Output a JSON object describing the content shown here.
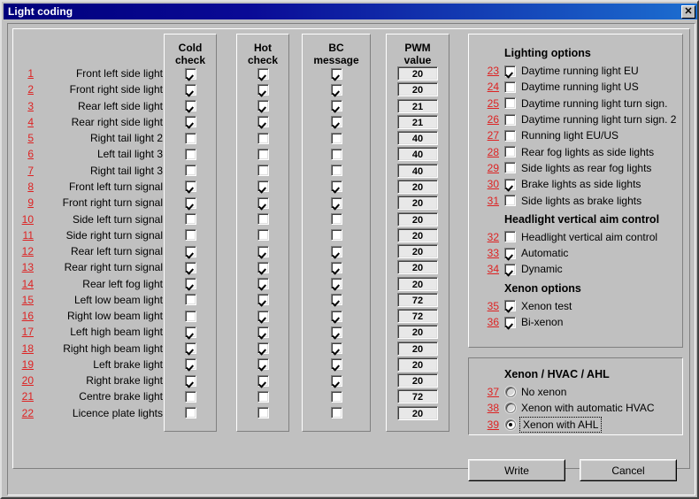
{
  "window": {
    "title": "Light coding",
    "close_label": "✕",
    "close_icon": "close-icon"
  },
  "columns": {
    "cold_check": "Cold\ncheck",
    "cold_check_line1": "Cold",
    "cold_check_line2": "check",
    "hot_check_line1": "Hot",
    "hot_check_line2": "check",
    "bc_message_line1": "BC",
    "bc_message_line2": "message",
    "pwm_line1": "PWM",
    "pwm_line2": "value"
  },
  "lights": [
    {
      "num": "1",
      "label": "Front left side light",
      "cold": true,
      "hot": true,
      "bc": true,
      "pwm": "20"
    },
    {
      "num": "2",
      "label": "Front right side light",
      "cold": true,
      "hot": true,
      "bc": true,
      "pwm": "20"
    },
    {
      "num": "3",
      "label": "Rear left side light",
      "cold": true,
      "hot": true,
      "bc": true,
      "pwm": "21"
    },
    {
      "num": "4",
      "label": "Rear right side light",
      "cold": true,
      "hot": true,
      "bc": true,
      "pwm": "21"
    },
    {
      "num": "5",
      "label": "Right tail light 2",
      "cold": false,
      "hot": false,
      "bc": false,
      "pwm": "40"
    },
    {
      "num": "6",
      "label": "Left tail light 3",
      "cold": false,
      "hot": false,
      "bc": false,
      "pwm": "40"
    },
    {
      "num": "7",
      "label": "Right tail light 3",
      "cold": false,
      "hot": false,
      "bc": false,
      "pwm": "40"
    },
    {
      "num": "8",
      "label": "Front left turn signal",
      "cold": true,
      "hot": true,
      "bc": true,
      "pwm": "20"
    },
    {
      "num": "9",
      "label": "Front right turn signal",
      "cold": true,
      "hot": true,
      "bc": true,
      "pwm": "20"
    },
    {
      "num": "10",
      "label": "Side left turn signal",
      "cold": false,
      "hot": false,
      "bc": false,
      "pwm": "20"
    },
    {
      "num": "11",
      "label": "Side right turn signal",
      "cold": false,
      "hot": false,
      "bc": false,
      "pwm": "20"
    },
    {
      "num": "12",
      "label": "Rear left turn signal",
      "cold": true,
      "hot": true,
      "bc": true,
      "pwm": "20"
    },
    {
      "num": "13",
      "label": "Rear right turn signal",
      "cold": true,
      "hot": true,
      "bc": true,
      "pwm": "20"
    },
    {
      "num": "14",
      "label": "Rear left fog light",
      "cold": true,
      "hot": true,
      "bc": true,
      "pwm": "20"
    },
    {
      "num": "15",
      "label": "Left low beam light",
      "cold": false,
      "hot": true,
      "bc": true,
      "pwm": "72"
    },
    {
      "num": "16",
      "label": "Right low beam light",
      "cold": false,
      "hot": true,
      "bc": true,
      "pwm": "72"
    },
    {
      "num": "17",
      "label": "Left high beam light",
      "cold": true,
      "hot": true,
      "bc": true,
      "pwm": "20"
    },
    {
      "num": "18",
      "label": "Right high beam light",
      "cold": true,
      "hot": true,
      "bc": true,
      "pwm": "20"
    },
    {
      "num": "19",
      "label": "Left brake light",
      "cold": true,
      "hot": true,
      "bc": true,
      "pwm": "20"
    },
    {
      "num": "20",
      "label": "Right brake light",
      "cold": true,
      "hot": true,
      "bc": true,
      "pwm": "20"
    },
    {
      "num": "21",
      "label": "Centre brake light",
      "cold": false,
      "hot": false,
      "bc": false,
      "pwm": "72"
    },
    {
      "num": "22",
      "label": "Licence plate lights",
      "cold": false,
      "hot": false,
      "bc": false,
      "pwm": "20"
    }
  ],
  "lighting_options": {
    "title": "Lighting options",
    "items": [
      {
        "num": "23",
        "label": "Daytime running light EU",
        "checked": true
      },
      {
        "num": "24",
        "label": "Daytime running light US",
        "checked": false
      },
      {
        "num": "25",
        "label": "Daytime running light turn sign.",
        "checked": false
      },
      {
        "num": "26",
        "label": "Daytime running light turn sign. 2",
        "checked": false
      },
      {
        "num": "27",
        "label": "Running light EU/US",
        "checked": false
      },
      {
        "num": "28",
        "label": "Rear fog lights as side lights",
        "checked": false
      },
      {
        "num": "29",
        "label": "Side lights as rear fog lights",
        "checked": false
      },
      {
        "num": "30",
        "label": "Brake lights as side lights",
        "checked": true
      },
      {
        "num": "31",
        "label": "Side lights as brake lights",
        "checked": false
      }
    ]
  },
  "aim_control": {
    "title": "Headlight vertical aim control",
    "items": [
      {
        "num": "32",
        "label": "Headlight vertical aim control",
        "checked": false
      },
      {
        "num": "33",
        "label": "Automatic",
        "checked": true
      },
      {
        "num": "34",
        "label": "Dynamic",
        "checked": true
      }
    ]
  },
  "xenon_options": {
    "title": "Xenon options",
    "items": [
      {
        "num": "35",
        "label": "Xenon test",
        "checked": true
      },
      {
        "num": "36",
        "label": "Bi-xenon",
        "checked": true
      }
    ]
  },
  "xenon_hvac_ahl": {
    "title": "Xenon / HVAC / AHL",
    "items": [
      {
        "num": "37",
        "label": "No xenon",
        "selected": false
      },
      {
        "num": "38",
        "label": "Xenon with automatic HVAC",
        "selected": false
      },
      {
        "num": "39",
        "label": "Xenon with AHL",
        "selected": true
      }
    ]
  },
  "buttons": {
    "write": "Write",
    "cancel": "Cancel"
  },
  "colors": {
    "accent_number": "#dd2222",
    "title_bar_start": "#00007b",
    "title_bar_end": "#1c6ed0",
    "face": "#c0c0c0"
  }
}
